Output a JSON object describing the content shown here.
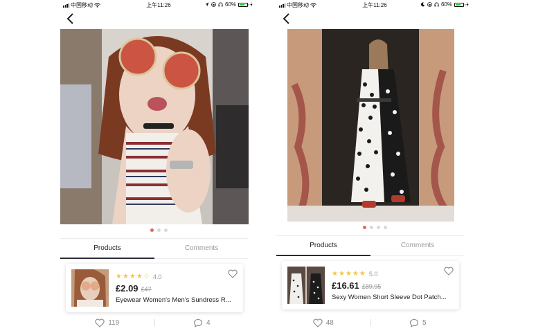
{
  "status_bar": {
    "carrier": "中国移动",
    "time": "上午11:26",
    "battery": "60%"
  },
  "colors": {
    "accent": "#e2636c",
    "star": "#f5c34a",
    "tab_indicator": "#2b2b3a"
  },
  "screens": [
    {
      "tabs": {
        "products": "Products",
        "comments": "Comments",
        "active": "Products"
      },
      "carousel": {
        "pages": 3,
        "active_index": 0
      },
      "product": {
        "rating": "4.0",
        "stars": 4,
        "price": "£2.09",
        "old_price": "£47",
        "title": "Eyewear Women's Men's Sundress R..."
      },
      "footer": {
        "likes": "119",
        "comments": "4"
      }
    },
    {
      "tabs": {
        "products": "Products",
        "comments": "Comments",
        "active": "Products"
      },
      "carousel": {
        "pages": 4,
        "active_index": 0
      },
      "product": {
        "rating": "5.0",
        "stars": 5,
        "price": "£16.61",
        "old_price": "£89.95",
        "title": "Sexy Women Short Sleeve Dot Patch..."
      },
      "footer": {
        "likes": "48",
        "comments": "5"
      }
    }
  ]
}
